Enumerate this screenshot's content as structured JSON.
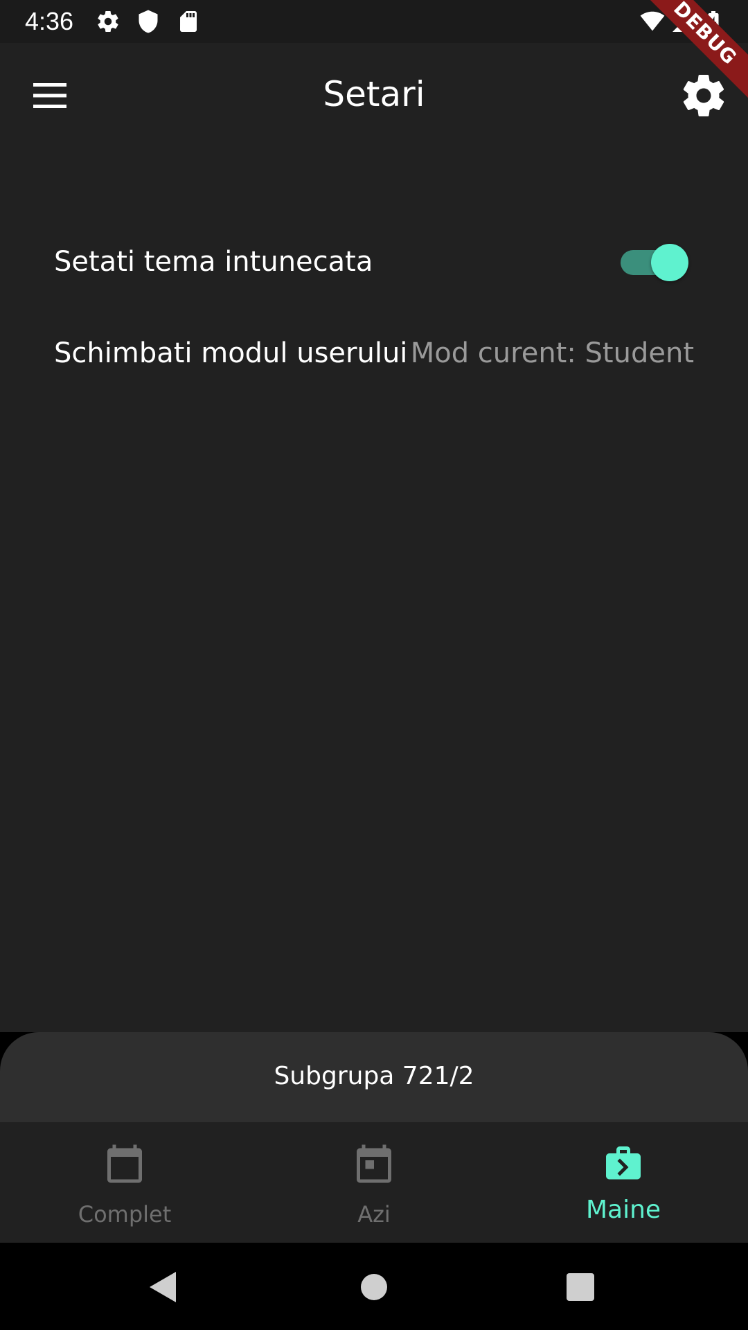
{
  "status_bar": {
    "time": "4:36",
    "icons": [
      "settings-gear-icon",
      "shield-icon",
      "sd-card-icon",
      "wifi-icon",
      "signal-icon",
      "battery-charging-icon"
    ]
  },
  "debug_banner": "DEBUG",
  "app_bar": {
    "title": "Setari",
    "menu_icon": "hamburger-menu-icon",
    "settings_icon": "gear-icon"
  },
  "settings": {
    "dark_theme_label": "Setati tema intunecata",
    "dark_theme_enabled": true,
    "user_mode_label": "Schimbati modul userului",
    "user_mode_value": "Mod curent: Student"
  },
  "subgroup": {
    "label": "Subgrupa 721/2"
  },
  "bottom_nav": {
    "items": [
      {
        "label": "Complet",
        "icon": "calendar-icon",
        "active": false
      },
      {
        "label": "Azi",
        "icon": "calendar-today-icon",
        "active": false
      },
      {
        "label": "Maine",
        "icon": "briefcase-next-icon",
        "active": true
      }
    ]
  },
  "colors": {
    "accent": "#5ff2cf",
    "toggle_track": "#3b8f7c",
    "background": "#212121",
    "sheet": "#2f2f2f",
    "debug": "#8b1a1a",
    "inactive": "#6f6f6f"
  },
  "system_nav": [
    "back-icon",
    "home-icon",
    "recents-icon"
  ]
}
